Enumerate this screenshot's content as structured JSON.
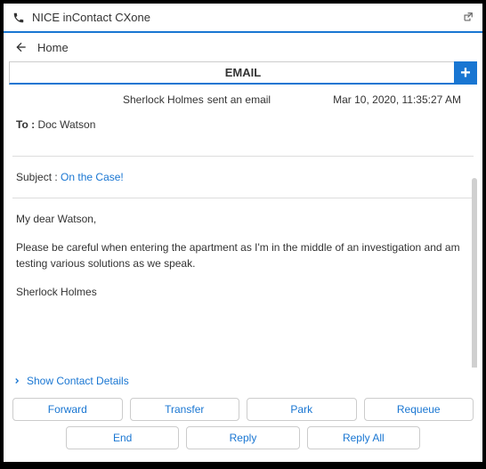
{
  "title_bar": {
    "app_name": "NICE inContact CXone"
  },
  "nav": {
    "home_label": "Home"
  },
  "email_header": {
    "title": "EMAIL"
  },
  "info": {
    "sender": "Sherlock Holmes",
    "status": "sent an email",
    "timestamp": "Mar 10, 2020, 11:35:27 AM"
  },
  "to": {
    "label": "To :",
    "value": "Doc Watson"
  },
  "subject": {
    "label": "Subject :",
    "value": "On the Case!"
  },
  "body": {
    "greeting": "My dear Watson,",
    "paragraph": "Please be careful when entering the apartment as I'm in the middle of an investigation and am testing various solutions as we speak.",
    "signature": "Sherlock Holmes"
  },
  "contact": {
    "show_label": "Show Contact Details"
  },
  "actions": {
    "forward": "Forward",
    "transfer": "Transfer",
    "park": "Park",
    "requeue": "Requeue",
    "end": "End",
    "reply": "Reply",
    "reply_all": "Reply All"
  }
}
